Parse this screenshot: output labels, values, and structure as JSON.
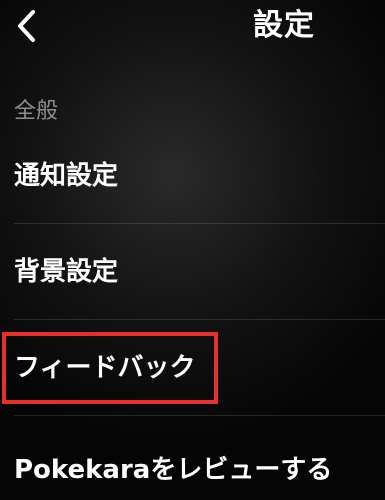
{
  "nav": {
    "title": "設定"
  },
  "section": {
    "header": "全般"
  },
  "settings_items": [
    {
      "label": "通知設定"
    },
    {
      "label": "背景設定"
    },
    {
      "label": "フィードバック"
    },
    {
      "label": "Pokekaraをレビューする"
    }
  ],
  "colors": {
    "text": "#ffffff",
    "section_header": "#8e8e8e",
    "highlight": "#e5302b",
    "background": "#121212"
  }
}
